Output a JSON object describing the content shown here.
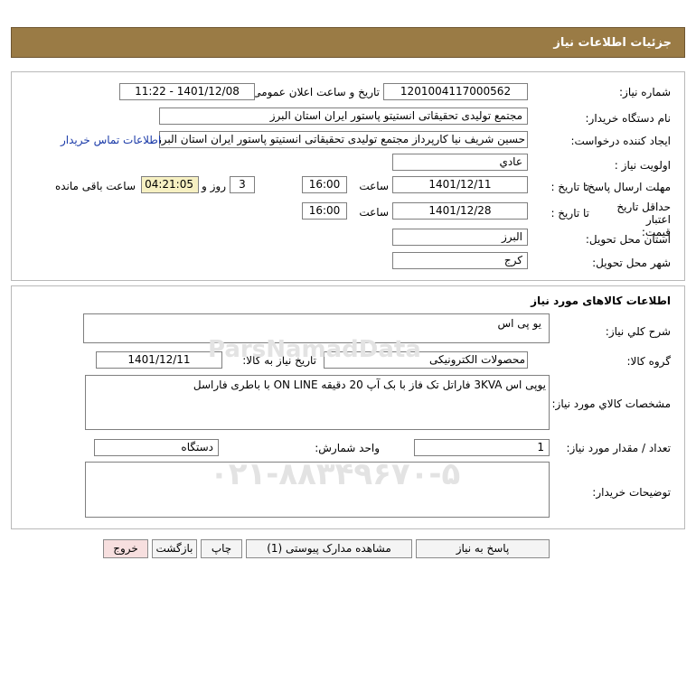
{
  "header": {
    "title": "جزئیات اطلاعات نیاز"
  },
  "info": {
    "need_number_label": "شماره نیاز:",
    "need_number": "1201004117000562",
    "announce_label": "تاریخ و ساعت اعلان عمومی:",
    "announce_value": "1401/12/08 - 11:22",
    "buyer_label": "نام دستگاه خریدار:",
    "buyer_value": "مجتمع تولیدی تحقیقاتی انستیتو پاستور ایران استان البرز",
    "creator_label": "ایجاد کننده درخواست:",
    "creator_value": "حسین شریف نیا کارپرداز مجتمع تولیدی تحقیقاتی انستیتو پاستور ایران استان البرز",
    "contact_link": "اطلاعات تماس خریدار",
    "priority_label": "اولویت نیاز :",
    "priority_value": "عادي",
    "deadline_label": "مهلت ارسال پاسخ:",
    "to_date_label": "تا تاریخ :",
    "deadline_date": "1401/12/11",
    "time_label": "ساعت",
    "deadline_time": "16:00",
    "days_value": "3",
    "days_label": "روز و",
    "remaining_value": "04:21:05",
    "remaining_label": "ساعت باقی مانده",
    "validity_label": "حداقل تاریخ اعتبار قیمت:",
    "validity_to_label": "تا تاریخ :",
    "validity_date": "1401/12/28",
    "validity_time_label": "ساعت",
    "validity_time": "16:00",
    "province_label": "استان محل تحویل:",
    "province_value": "البرز",
    "city_label": "شهر محل تحویل:",
    "city_value": "کرج"
  },
  "goods": {
    "section_title": "اطلاعات کالاهای مورد نیاز",
    "desc_label": "شرح کلي نیاز:",
    "desc_value": "یو پی اس",
    "group_label": "گروه کالا:",
    "group_value": "محصولات الکترونیکی",
    "need_date_label": "تاریخ نیاز به کالا:",
    "need_date_value": "1401/12/11",
    "spec_label": "مشخصات کالاي مورد نیاز:",
    "spec_value": "یوپی اس 3KVA فاراتل تک فاز با بک آپ 20 دقیقه ON LINE با باطری فاراسل",
    "qty_label": "تعداد / مقدار مورد نیاز:",
    "qty_value": "1",
    "unit_label": "واحد شمارش:",
    "unit_value": "دستگاه",
    "notes_label": "توضیحات خریدار:",
    "notes_value": ""
  },
  "buttons": {
    "reply": "پاسخ به نیاز",
    "docs": "مشاهده مدارک پیوستی (1)",
    "print": "چاپ",
    "back": "بازگشت",
    "exit": "خروج"
  },
  "watermark": {
    "brand": "ParsNamadData",
    "phone": "۰۲۱-۸۸۳۴۹۶۷۰-۵"
  },
  "colors": {
    "header_bg": "#9a7b45",
    "remaining_bg": "#f6f0c2",
    "exit_bg": "#f7dfdf",
    "link": "#1a3aa8"
  }
}
